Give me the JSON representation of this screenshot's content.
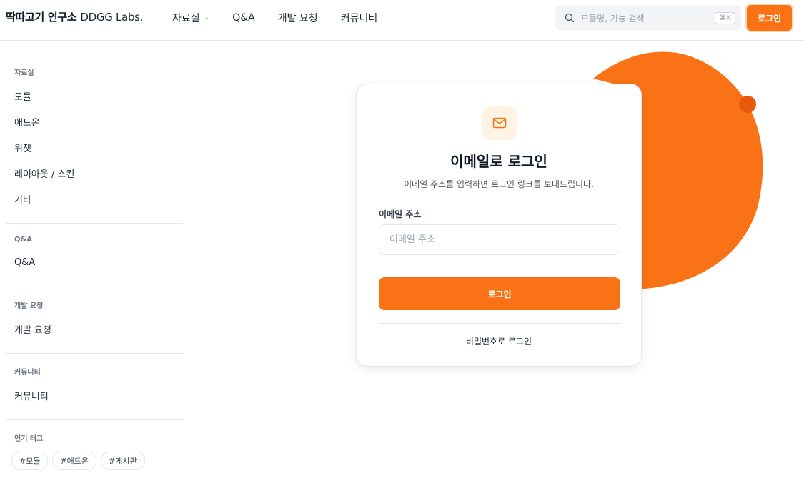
{
  "header": {
    "brand_name": "딱따고기 연구소",
    "brand_sub": "DDGG Labs.",
    "nav": [
      {
        "label": "자료실",
        "has_dropdown": true
      },
      {
        "label": "Q&A"
      },
      {
        "label": "개발 요청"
      },
      {
        "label": "커뮤니티"
      }
    ],
    "search_placeholder": "모듈명, 기능 검색",
    "search_shortcut": "⌘K",
    "login_label": "로그인"
  },
  "sidebar": {
    "sections": [
      {
        "title": "자료실",
        "items": [
          "모듈",
          "애드온",
          "위젯",
          "레이아웃 / 스킨",
          "기타"
        ]
      },
      {
        "title": "Q&A",
        "items": [
          "Q&A"
        ]
      },
      {
        "title": "개발 요청",
        "items": [
          "개발 요청"
        ]
      },
      {
        "title": "커뮤니티",
        "items": [
          "커뮤니티"
        ]
      }
    ],
    "tags_title": "인기 태그",
    "tags": [
      "#모듈",
      "#애드온",
      "#게시판"
    ]
  },
  "login_card": {
    "title": "이메일로 로그인",
    "subtitle": "이메일 주소를 입력하면 로그인 링크를 보내드립니다.",
    "email_label": "이메일 주소",
    "email_placeholder": "이메일 주소",
    "email_value": "",
    "submit_label": "로그인",
    "alt_login_label": "비밀번호로 로그인"
  },
  "colors": {
    "accent": "#f97316",
    "accent_light": "#fff3e6",
    "blob": "#f97316",
    "blob_dot": "#ea580c"
  },
  "icons": {
    "search": "search-icon",
    "mail": "mail-icon",
    "dropdown": "chevron-down-icon"
  }
}
